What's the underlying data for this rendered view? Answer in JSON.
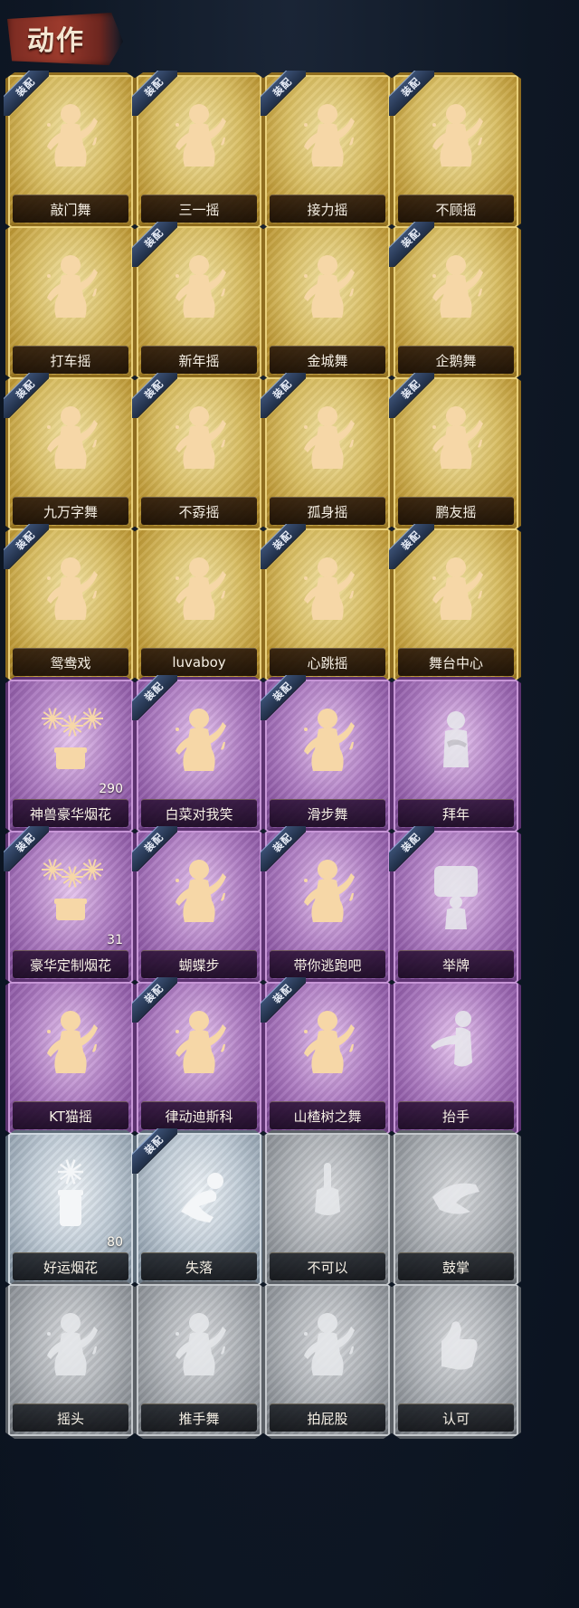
{
  "header": {
    "title": "动作"
  },
  "badge_text": "装配",
  "colors": {
    "gold": "#d8bd62",
    "purple": "#b07fc4",
    "silver": "#bfcbd6",
    "gray": "#aeb2b7",
    "badge": "#2b3c5a"
  },
  "cards": [
    {
      "label": "敲门舞",
      "tier": "gold",
      "equipped": true,
      "icon": "dance-pose-icon"
    },
    {
      "label": "三一摇",
      "tier": "gold",
      "equipped": true,
      "icon": "dance-pose-icon"
    },
    {
      "label": "接力摇",
      "tier": "gold",
      "equipped": true,
      "icon": "dance-pose-icon"
    },
    {
      "label": "不顾摇",
      "tier": "gold",
      "equipped": true,
      "icon": "dance-pose-icon"
    },
    {
      "label": "打车摇",
      "tier": "gold",
      "equipped": false,
      "icon": "dance-pose-icon"
    },
    {
      "label": "新年摇",
      "tier": "gold",
      "equipped": true,
      "icon": "dance-pose-icon"
    },
    {
      "label": "金城舞",
      "tier": "gold",
      "equipped": false,
      "icon": "dance-pose-icon"
    },
    {
      "label": "企鹅舞",
      "tier": "gold",
      "equipped": true,
      "icon": "dance-pose-icon"
    },
    {
      "label": "九万字舞",
      "tier": "gold",
      "equipped": true,
      "icon": "dance-pose-icon"
    },
    {
      "label": "不孬摇",
      "tier": "gold",
      "equipped": true,
      "icon": "dance-pose-icon"
    },
    {
      "label": "孤身摇",
      "tier": "gold",
      "equipped": true,
      "icon": "dance-pose-icon"
    },
    {
      "label": "鹏友摇",
      "tier": "gold",
      "equipped": true,
      "icon": "dance-pose-icon"
    },
    {
      "label": "鸳鸯戏",
      "tier": "gold",
      "equipped": true,
      "icon": "dance-pose-icon"
    },
    {
      "label": "luvaboy",
      "tier": "gold",
      "equipped": false,
      "icon": "dance-pose-icon"
    },
    {
      "label": "心跳摇",
      "tier": "gold",
      "equipped": true,
      "icon": "dance-pose-icon"
    },
    {
      "label": "舞台中心",
      "tier": "gold",
      "equipped": true,
      "icon": "dance-pose-icon"
    },
    {
      "label": "神兽豪华烟花",
      "tier": "purple",
      "equipped": false,
      "icon": "fireworks-icon",
      "count": "290"
    },
    {
      "label": "白菜对我笑",
      "tier": "purple",
      "equipped": true,
      "icon": "dance-pose-icon"
    },
    {
      "label": "滑步舞",
      "tier": "purple",
      "equipped": true,
      "icon": "dance-pose-icon"
    },
    {
      "label": "拜年",
      "tier": "purple",
      "equipped": false,
      "icon": "bow-pose-icon",
      "dim": true
    },
    {
      "label": "豪华定制烟花",
      "tier": "purple",
      "equipped": true,
      "icon": "fireworks-icon",
      "count": "31"
    },
    {
      "label": "蝴蝶步",
      "tier": "purple",
      "equipped": true,
      "icon": "dance-pose-icon"
    },
    {
      "label": "带你逃跑吧",
      "tier": "purple",
      "equipped": true,
      "icon": "dance-pose-icon"
    },
    {
      "label": "举牌",
      "tier": "purple",
      "equipped": true,
      "icon": "sign-pose-icon",
      "dim": true
    },
    {
      "label": "KT猫摇",
      "tier": "purple",
      "equipped": false,
      "icon": "dance-pose-icon"
    },
    {
      "label": "律动迪斯科",
      "tier": "purple",
      "equipped": true,
      "icon": "dance-pose-icon"
    },
    {
      "label": "山楂树之舞",
      "tier": "purple",
      "equipped": true,
      "icon": "dance-pose-icon"
    },
    {
      "label": "抬手",
      "tier": "purple",
      "equipped": false,
      "icon": "raise-hand-icon",
      "dim": true
    },
    {
      "label": "好运烟花",
      "tier": "silver",
      "equipped": false,
      "icon": "firework-can-icon",
      "count": "80"
    },
    {
      "label": "失落",
      "tier": "silver",
      "equipped": true,
      "icon": "kneel-pose-icon"
    },
    {
      "label": "不可以",
      "tier": "gray",
      "equipped": false,
      "icon": "finger-wag-icon",
      "dim": true
    },
    {
      "label": "鼓掌",
      "tier": "gray",
      "equipped": false,
      "icon": "clap-icon",
      "dim": true
    },
    {
      "label": "摇头",
      "tier": "gray",
      "equipped": false,
      "icon": "dance-pose-icon",
      "dim": true
    },
    {
      "label": "推手舞",
      "tier": "gray",
      "equipped": false,
      "icon": "dance-pose-icon",
      "dim": true
    },
    {
      "label": "拍屁股",
      "tier": "gray",
      "equipped": false,
      "icon": "dance-pose-icon",
      "dim": true
    },
    {
      "label": "认可",
      "tier": "gray",
      "equipped": false,
      "icon": "thumbs-up-icon",
      "dim": true
    }
  ]
}
